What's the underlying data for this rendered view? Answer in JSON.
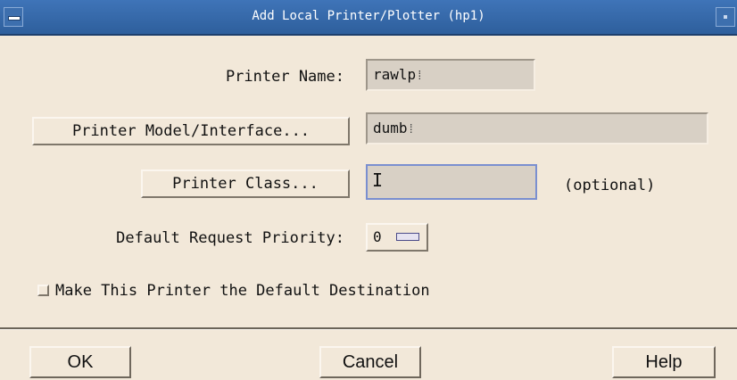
{
  "window": {
    "title": "Add Local Printer/Plotter (hp1)"
  },
  "form": {
    "printer_name_label": "Printer Name:",
    "printer_name_value": "rawlp",
    "model_button_label": "Printer Model/Interface...",
    "model_value": "dumb",
    "class_button_label": "Printer Class...",
    "class_value": "",
    "class_optional_note": "(optional)",
    "priority_label": "Default Request Priority:",
    "priority_value": "0",
    "default_checkbox_label": "Make This Printer the Default Destination",
    "default_checkbox_checked": false
  },
  "actions": {
    "ok_label": "OK",
    "cancel_label": "Cancel",
    "help_label": "Help"
  },
  "colors": {
    "titlebar": "#2e5f9c",
    "background": "#f2e8d9",
    "field": "#d8d0c5"
  }
}
